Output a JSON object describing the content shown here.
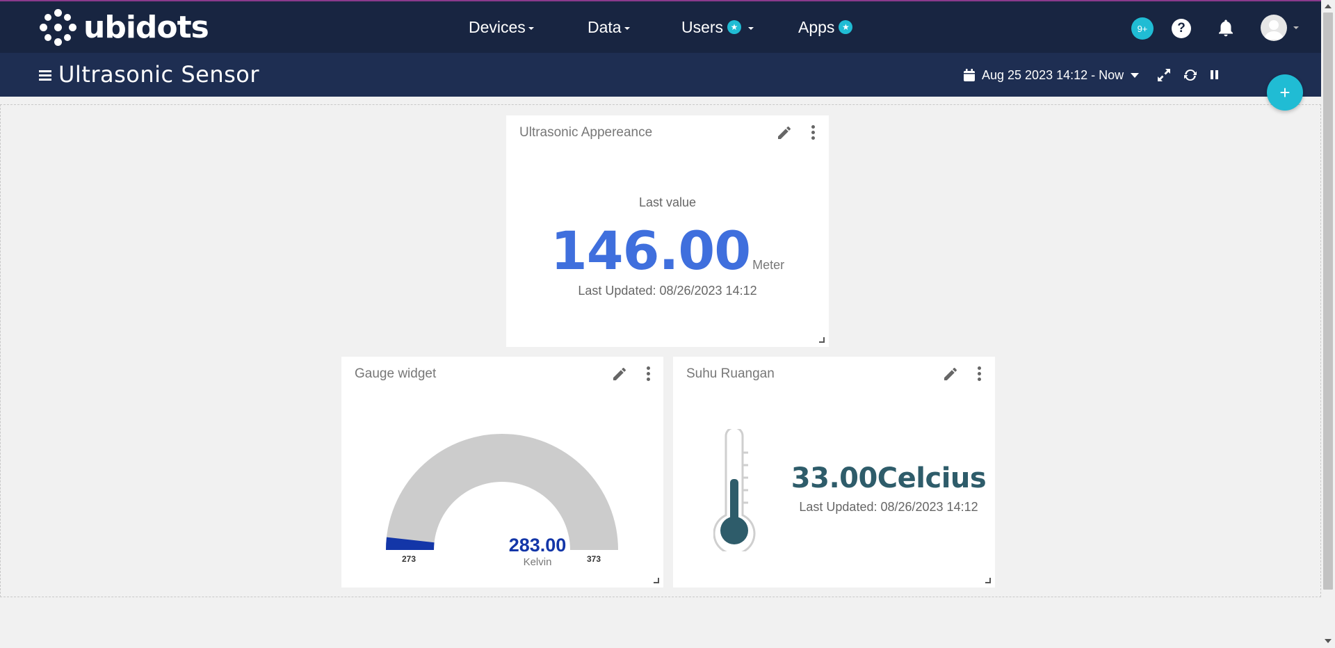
{
  "brand": {
    "logo_text": "ubidots"
  },
  "nav": {
    "items": [
      {
        "label": "Devices",
        "has_caret": true,
        "has_badge": false
      },
      {
        "label": "Data",
        "has_caret": true,
        "has_badge": false
      },
      {
        "label": "Users",
        "has_caret": true,
        "has_badge": true
      },
      {
        "label": "Apps",
        "has_caret": false,
        "has_badge": true
      }
    ],
    "notification_count": "9+",
    "help_label": "?"
  },
  "header": {
    "title": "Ultrasonic Sensor",
    "date_range": "Aug 25 2023 14:12 - Now",
    "add_label": "+"
  },
  "widgets": {
    "last_value": {
      "title": "Ultrasonic Appereance",
      "label": "Last value",
      "value": "146.00",
      "unit": "Meter",
      "updated": "Last Updated: 08/26/2023 14:12"
    },
    "gauge": {
      "title": "Gauge widget",
      "value": "283.00",
      "unit": "Kelvin",
      "min": "273",
      "max": "373",
      "level": 0.1,
      "fill_color": "#1336a8",
      "track_color": "#cccccc"
    },
    "thermometer": {
      "title": "Suhu Ruangan",
      "value": "33.00Celcius",
      "updated": "Last Updated: 08/26/2023 14:12",
      "fill_color": "#2e5c6a"
    }
  },
  "colors": {
    "topbar": "#182541",
    "subbar": "#1e2e52",
    "accent": "#20bcd4",
    "last_value_blue": "#3f6fdd"
  }
}
